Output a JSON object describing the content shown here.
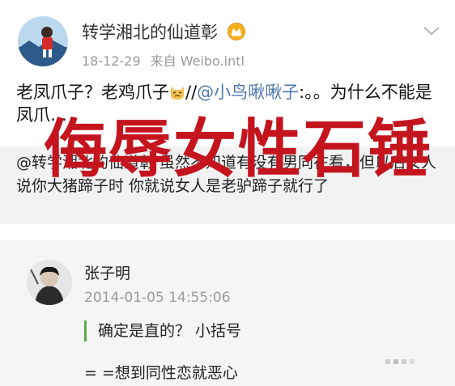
{
  "post1": {
    "username": "转学湘北的仙道彰",
    "badge_icon": "gold-verified-badge-icon",
    "date": "18-12-29",
    "source": "来自 Weibo.intl",
    "text_part1": "老凤爪子？老鸡爪子",
    "emoji": "cat-emoji-icon",
    "text_part2": "//",
    "mention": "@小鸟啾啾子",
    "text_part3": ":。。为什么不能是凤爪…",
    "repost_text": "@转学湘北的仙道彰 虽然不知道有没有男同在看，但以后女人说你大猪蹄子时 你就说女人是老驴蹄子就行了"
  },
  "overlay_title": "侮辱女性石锤",
  "post2": {
    "username": "张子明",
    "timestamp": "2014-01-05 14:55:06",
    "quote": "确定是直的？ 小括号",
    "comment": "= =想到同性恋就恶心"
  },
  "colors": {
    "mention": "#4f79b0",
    "overlay_red": "#c4141e",
    "quote_bar": "#5aa84a",
    "meta_gray": "#9a9a9a"
  }
}
